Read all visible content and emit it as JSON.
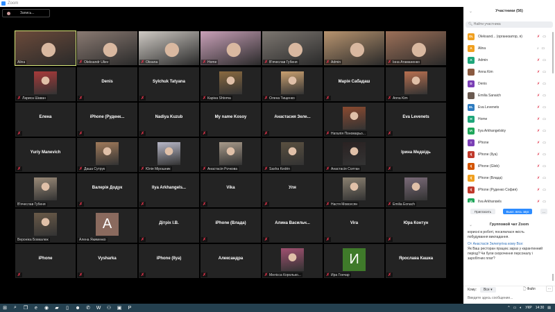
{
  "window": {
    "title": "Zoom"
  },
  "toolbar": {
    "record_label": "Запись..."
  },
  "tiles": [
    [
      {
        "name": "Alina",
        "type": "video",
        "muted": false,
        "active": true,
        "bg": "#6b4a3a"
      },
      {
        "name": "Oleksandr Uliev",
        "type": "video",
        "muted": true,
        "bg": "#8a7a72"
      },
      {
        "name": "Oksana",
        "type": "video",
        "muted": true,
        "bg": "#cfcac4"
      },
      {
        "name": "Home",
        "type": "video",
        "muted": true,
        "bg": "#c9a0b8"
      },
      {
        "name": "В'ячеслав Губеня",
        "type": "video",
        "muted": true,
        "bg": "#7c7670"
      },
      {
        "name": "Admin",
        "type": "video",
        "muted": true,
        "bg": "#b8946f"
      },
      {
        "name": "Інна Атаманенко",
        "type": "video",
        "muted": true,
        "bg": "#9c7058"
      }
    ],
    [
      {
        "name": "Лариса Шаван",
        "type": "photo",
        "muted": true,
        "bg": "#a83a3a"
      },
      {
        "name": "Denis",
        "type": "name",
        "muted": true
      },
      {
        "name": "Sylchuk Tatyana",
        "type": "name",
        "muted": true
      },
      {
        "name": "Каріна Shtoma",
        "type": "photo",
        "muted": true,
        "bg": "#8a6a40"
      },
      {
        "name": "Олена Тищенко",
        "type": "photo",
        "muted": true,
        "bg": "#c9a070"
      },
      {
        "name": "Марія Сабадаш",
        "type": "name",
        "muted": true
      },
      {
        "name": "Anna Kim",
        "type": "photo",
        "muted": true,
        "bg": "#b87050"
      }
    ],
    [
      {
        "name": "Елена",
        "type": "name",
        "muted": true
      },
      {
        "name": "iPhone  (Руденк...",
        "type": "name",
        "muted": true
      },
      {
        "name": "Nadiya Kuzub",
        "type": "name",
        "muted": true
      },
      {
        "name": "My name Kosoy",
        "type": "name",
        "muted": true
      },
      {
        "name": "Анастасия  Зеле...",
        "type": "name",
        "muted": true
      },
      {
        "name": "Наталія Пономарьо...",
        "type": "photo",
        "muted": true,
        "bg": "#8a4a30"
      },
      {
        "name": "Eva Levenets",
        "type": "name",
        "muted": true
      }
    ],
    [
      {
        "name": "Yuriy Manevich",
        "type": "name",
        "muted": true
      },
      {
        "name": "Даша Сутрук",
        "type": "photo",
        "muted": true,
        "bg": "#a07a5a"
      },
      {
        "name": "Юлія Мірошник",
        "type": "photo",
        "muted": true,
        "bg": "#b8b8c8"
      },
      {
        "name": "Анастасія Рєчкова",
        "type": "photo",
        "muted": true,
        "bg": "#a89a8a"
      },
      {
        "name": "Sasha Kedrin",
        "type": "photo",
        "muted": true,
        "bg": "#5a5040"
      },
      {
        "name": "Анастасія Солтан",
        "type": "photo",
        "muted": true,
        "bg": "#2a2222"
      },
      {
        "name": "Ірина Медвідь",
        "type": "name",
        "muted": true
      }
    ],
    [
      {
        "name": "В'ячеслав Губеня",
        "type": "photo",
        "muted": false,
        "bg": "#9a8a78"
      },
      {
        "name": "Валерія Додук",
        "type": "name",
        "muted": true
      },
      {
        "name": "Ilya  Arkhangels...",
        "type": "name",
        "muted": true
      },
      {
        "name": "Vika",
        "type": "name",
        "muted": true
      },
      {
        "name": "Уля",
        "type": "name",
        "muted": true
      },
      {
        "name": "Настя Мовсесян",
        "type": "photo",
        "muted": true,
        "bg": "#8a8070"
      },
      {
        "name": "Emilia Eonach",
        "type": "photo",
        "muted": true,
        "bg": "#7a6a78"
      }
    ],
    [
      {
        "name": "Вероніка Бовкалюк",
        "type": "photo",
        "muted": false,
        "bg": "#6a5a48"
      },
      {
        "name": "Алена Якименко",
        "type": "letter",
        "letter": "A",
        "muted": false,
        "bg": "#8a6a5e"
      },
      {
        "name": "Дітріх І.В.",
        "type": "name",
        "muted": true
      },
      {
        "name": "iPhone (Влада)",
        "type": "name",
        "muted": true
      },
      {
        "name": "Алина  Васильч...",
        "type": "name",
        "muted": true
      },
      {
        "name": "Vira",
        "type": "name",
        "muted": true
      },
      {
        "name": "Юра Контун",
        "type": "name",
        "muted": true
      }
    ],
    [
      {
        "name": "iPhone",
        "type": "name",
        "muted": true
      },
      {
        "name": "Vysharka",
        "type": "name",
        "muted": true
      },
      {
        "name": "iPhone (Ilya)",
        "type": "name",
        "muted": true
      },
      {
        "name": "Александра",
        "type": "name",
        "muted": true
      },
      {
        "name": "Мелісса Королько...",
        "type": "photo",
        "muted": true,
        "bg": "#a05070"
      },
      {
        "name": "Ира Гончар",
        "type": "letter",
        "letter": "И",
        "muted": true,
        "bg": "#3f7a2a"
      },
      {
        "name": "Ярослава Кашка",
        "type": "name",
        "muted": true
      }
    ]
  ],
  "participants": {
    "title": "Участники (56)",
    "search_placeholder": "Найти участника",
    "items": [
      {
        "initials": "OL",
        "name": "Oleksand... (организатор, я)",
        "color": "#f0a020",
        "muted": true
      },
      {
        "initials": "A",
        "name": "Alina",
        "color": "#f0a020",
        "muted": false
      },
      {
        "initials": "A",
        "name": "Admin",
        "color": "#1fa67a",
        "muted": true
      },
      {
        "initials": "",
        "name": "Anna Kim",
        "color": "#8a5a40",
        "muted": true
      },
      {
        "initials": "D",
        "name": "Denis",
        "color": "#7b3fb5",
        "muted": true
      },
      {
        "initials": "",
        "name": "Emilia Sanaich",
        "color": "#6a5a50",
        "muted": true
      },
      {
        "initials": "EL",
        "name": "Eva Levenets",
        "color": "#2d7bbf",
        "muted": true
      },
      {
        "initials": "H",
        "name": "Home",
        "color": "#1fa67a",
        "muted": true
      },
      {
        "initials": "IA",
        "name": "Ilya Arkhangelskiy",
        "color": "#1fa65a",
        "muted": true
      },
      {
        "initials": "I",
        "name": "iPhone",
        "color": "#7b3fb5",
        "muted": true
      },
      {
        "initials": "I(",
        "name": "iPhone (Ilya)",
        "color": "#c0392b",
        "muted": true
      },
      {
        "initials": "I(",
        "name": "iPhone (Gleb)",
        "color": "#d35400",
        "muted": true
      },
      {
        "initials": "I(",
        "name": "iPhone (Влада)",
        "color": "#f0a020",
        "muted": true
      },
      {
        "initials": "I(",
        "name": "iPhone (Руденко София)",
        "color": "#c0392b",
        "muted": true
      },
      {
        "initials": "IA",
        "name": "Ilya Arkhangels",
        "color": "#1fa65a",
        "muted": true
      }
    ],
    "invite_label": "Пригласить",
    "mute_all_label": "Выкл. весь звук",
    "more_label": "..."
  },
  "chat": {
    "title": "Групповой чат Zoom",
    "prev_text": "корисні в роботі, посилилася якість побудування викладання.",
    "from": "От Анастасія Зелепугіна кому Все:",
    "message": "Як Ваш ресторан працює зараз у карантинний період? Чи були скорочення персоналу і заробітних плат?",
    "to_label": "Кому:",
    "to_value": "Все",
    "file_label": "Файл",
    "more_label": "...",
    "input_placeholder": "Введите здесь сообщение..."
  },
  "taskbar": {
    "icons": [
      "windows-start",
      "search",
      "task-view",
      "edge",
      "chrome",
      "file-explorer",
      "notepad",
      "app",
      "viber",
      "word",
      "network",
      "zoom",
      "powerpoint"
    ],
    "lang": "УКР",
    "time": "14:30"
  }
}
